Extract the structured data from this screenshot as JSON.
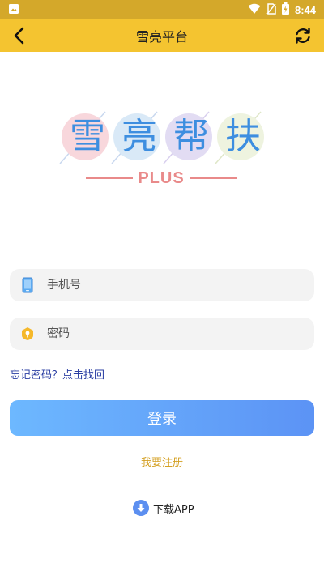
{
  "status_bar": {
    "time": "8:44",
    "icons": [
      "image-icon",
      "wifi-icon",
      "no-sim-icon",
      "battery-icon"
    ]
  },
  "app_bar": {
    "title": "雪亮平台",
    "back_icon": "back-arrow-icon",
    "refresh_icon": "refresh-icon",
    "color": "#f4c430"
  },
  "logo": {
    "chars": [
      "雪",
      "亮",
      "帮",
      "扶"
    ],
    "tag": "PLUS",
    "circle_colors": [
      "#f8d7dc",
      "#d9e9f7",
      "#e2dcf3",
      "#eef3df"
    ]
  },
  "form": {
    "phone": {
      "placeholder": "手机号",
      "value": "",
      "icon": "phone-icon"
    },
    "password": {
      "placeholder": "密码",
      "value": "",
      "icon": "key-icon"
    },
    "forgot_text": "忘记密码？点击找回",
    "login_label": "登录",
    "register_text": "我要注册",
    "download_text": "下载APP",
    "download_icon": "download-icon"
  }
}
